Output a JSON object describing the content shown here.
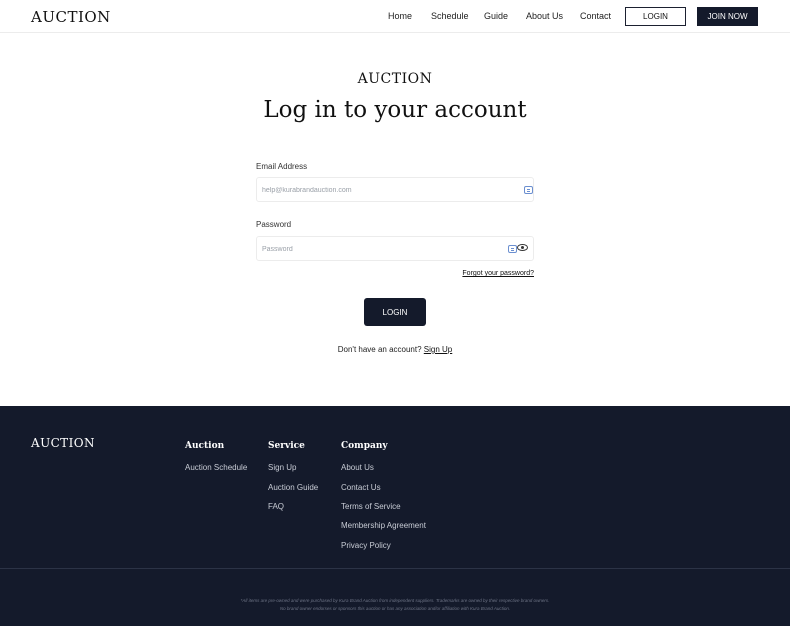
{
  "header": {
    "logo": "AUCTION",
    "nav": [
      "Home",
      "Schedule",
      "Guide",
      "About Us",
      "Contact"
    ],
    "login_label": "LOGIN",
    "join_label": "JOIN NOW"
  },
  "main": {
    "logo": "AUCTION",
    "title": "Log in to your account",
    "email_label": "Email Address",
    "email_placeholder": "help@kurabrandauction.com",
    "password_label": "Password",
    "password_placeholder": "Password",
    "forgot_link": "Forgot your password?",
    "login_button": "LOGIN",
    "signup_prompt": "Don't have an account?",
    "signup_link": "Sign Up"
  },
  "footer": {
    "logo": "AUCTION",
    "auction": {
      "title": "Auction",
      "links": [
        "Auction Schedule"
      ]
    },
    "service": {
      "title": "Service",
      "links": [
        "Sign Up",
        "Auction Guide",
        "FAQ"
      ]
    },
    "company": {
      "title": "Company",
      "links": [
        "About Us",
        "Contact Us",
        "Terms of Service",
        "Membership Agreement",
        "Privacy Policy"
      ]
    },
    "disclaimer_1": "*All items are pre-owned and were purchased by Kura Brand Auction from independent suppliers. Trademarks are owned by their respective brand owners.",
    "disclaimer_2": "No brand owner endorses or sponsors this auction or has any association and/or affiliation with Kura Brand Auction."
  },
  "colors": {
    "dark": "#141a2b",
    "accent_autofill": "#6b8fd0"
  },
  "icons": [
    "autofill-icon",
    "eye-icon"
  ]
}
